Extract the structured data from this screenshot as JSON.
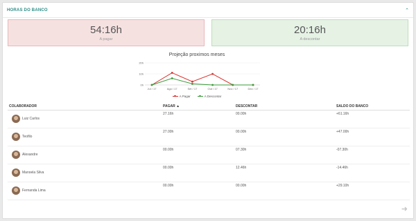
{
  "panel": {
    "title": "HORAS DO BANCO",
    "collapse_icon": "chevron-up-icon"
  },
  "cards": {
    "pay": {
      "value": "54:16h",
      "label": "A pagar",
      "color": "#f6e1e1"
    },
    "discount": {
      "value": "20:16h",
      "label": "A descontar",
      "color": "#e5f2e4"
    }
  },
  "chart_data": {
    "type": "line",
    "title": "Projeção proximos meses",
    "categories": [
      "Jul / 17",
      "Ago / 17",
      "Set / 17",
      "Out / 17",
      "Nov / 17",
      "Dez / 17"
    ],
    "y_ticks": [
      "0h",
      "10h",
      "20h"
    ],
    "ylim": [
      0,
      20
    ],
    "series": [
      {
        "name": "A Pagar",
        "color": "#d9302c",
        "values": [
          0,
          11,
          3,
          10,
          0,
          0
        ]
      },
      {
        "name": "A Descontar",
        "color": "#3a9a3a",
        "values": [
          0,
          6,
          1,
          0,
          0,
          0
        ]
      }
    ],
    "legend": "bottom"
  },
  "table": {
    "headers": [
      "COLABORADOR",
      "PAGAR",
      "DESCONTAR",
      "SALDO DO BANCO"
    ],
    "sort_icon": "arrow-up-icon",
    "rows": [
      {
        "name": "Luiz Carlos",
        "pagar": "27.16h",
        "descontar": "00.00h",
        "saldo": "+61.16h"
      },
      {
        "name": "Teofilo",
        "pagar": "27.00h",
        "descontar": "00.00h",
        "saldo": "+47.00h"
      },
      {
        "name": "Alexandre",
        "pagar": "00.00h",
        "descontar": "07.30h",
        "saldo": "-07.30h"
      },
      {
        "name": "Manoela Silva",
        "pagar": "00.00h",
        "descontar": "12.46h",
        "saldo": "-14.46h"
      },
      {
        "name": "Fernanda Lima",
        "pagar": "00.00h",
        "descontar": "00.00h",
        "saldo": "+29.10h"
      }
    ]
  },
  "next_icon": "arrow-right-icon"
}
